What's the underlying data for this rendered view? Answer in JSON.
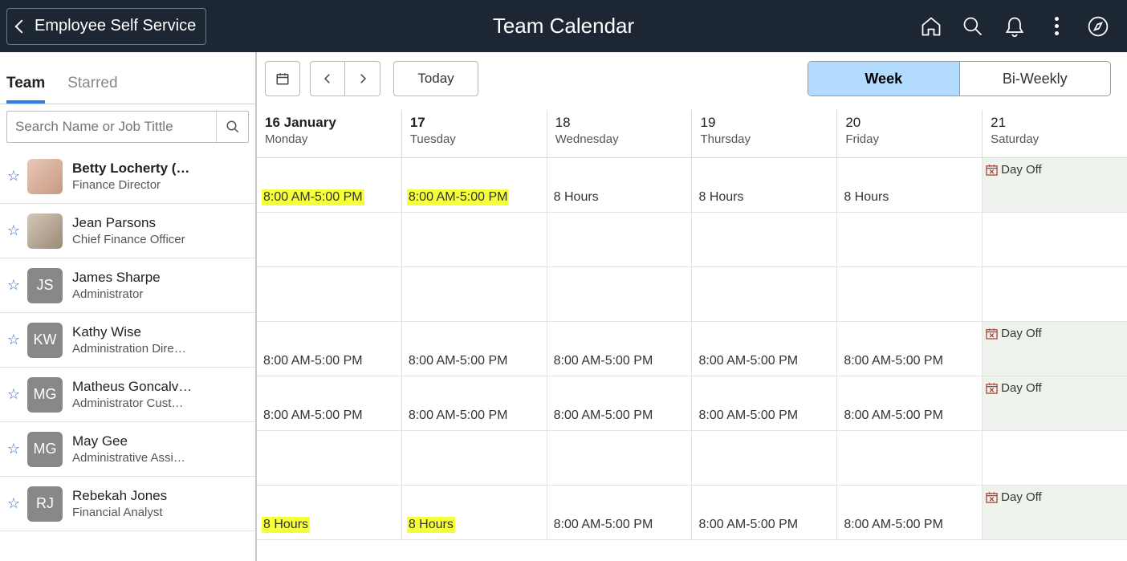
{
  "header": {
    "back_label": "Employee Self Service",
    "title": "Team Calendar"
  },
  "sidebar": {
    "tabs": {
      "team": "Team",
      "starred": "Starred"
    },
    "search_placeholder": "Search Name or Job Tittle",
    "members": [
      {
        "name": "Betty Locherty (…",
        "title": "Finance Director",
        "bold": true,
        "avatar_type": "photo1",
        "initials": ""
      },
      {
        "name": "Jean Parsons",
        "title": "Chief Finance Officer",
        "bold": false,
        "avatar_type": "photo2",
        "initials": ""
      },
      {
        "name": "James Sharpe",
        "title": "Administrator",
        "bold": false,
        "avatar_type": "initials",
        "initials": "JS"
      },
      {
        "name": "Kathy Wise",
        "title": "Administration Dire…",
        "bold": false,
        "avatar_type": "initials",
        "initials": "KW"
      },
      {
        "name": "Matheus Goncalv…",
        "title": "Administrator Cust…",
        "bold": false,
        "avatar_type": "initials",
        "initials": "MG"
      },
      {
        "name": "May Gee",
        "title": "Administrative Assi…",
        "bold": false,
        "avatar_type": "initials",
        "initials": "MG"
      },
      {
        "name": "Rebekah Jones",
        "title": "Financial Analyst",
        "bold": false,
        "avatar_type": "initials",
        "initials": "RJ"
      }
    ]
  },
  "toolbar": {
    "today": "Today",
    "segments": {
      "week": "Week",
      "biweekly": "Bi-Weekly"
    }
  },
  "days": [
    {
      "num": "16 January",
      "name": "Monday",
      "bold": true
    },
    {
      "num": "17",
      "name": "Tuesday",
      "bold": true
    },
    {
      "num": "18",
      "name": "Wednesday",
      "bold": false
    },
    {
      "num": "19",
      "name": "Thursday",
      "bold": false
    },
    {
      "num": "20",
      "name": "Friday",
      "bold": false
    },
    {
      "num": "21",
      "name": "Saturday",
      "bold": false
    }
  ],
  "dayoff_label": "Day Off",
  "grid": [
    [
      {
        "v": "8:00 AM-5:00 PM",
        "hl": true
      },
      {
        "v": "8:00 AM-5:00 PM",
        "hl": true
      },
      {
        "v": "8 Hours"
      },
      {
        "v": "8 Hours"
      },
      {
        "v": "8 Hours"
      },
      {
        "dayoff": true
      }
    ],
    [
      {},
      {},
      {},
      {},
      {},
      {}
    ],
    [
      {},
      {},
      {},
      {},
      {},
      {}
    ],
    [
      {
        "v": "8:00 AM-5:00 PM"
      },
      {
        "v": "8:00 AM-5:00 PM"
      },
      {
        "v": "8:00 AM-5:00 PM"
      },
      {
        "v": "8:00 AM-5:00 PM"
      },
      {
        "v": "8:00 AM-5:00 PM"
      },
      {
        "dayoff": true
      }
    ],
    [
      {
        "v": "8:00 AM-5:00 PM"
      },
      {
        "v": "8:00 AM-5:00 PM"
      },
      {
        "v": "8:00 AM-5:00 PM"
      },
      {
        "v": "8:00 AM-5:00 PM"
      },
      {
        "v": "8:00 AM-5:00 PM"
      },
      {
        "dayoff": true
      }
    ],
    [
      {},
      {},
      {},
      {},
      {},
      {}
    ],
    [
      {
        "v": "8 Hours",
        "hl": true
      },
      {
        "v": "8 Hours",
        "hl": true
      },
      {
        "v": "8:00 AM-5:00 PM"
      },
      {
        "v": "8:00 AM-5:00 PM"
      },
      {
        "v": "8:00 AM-5:00 PM"
      },
      {
        "dayoff": true
      }
    ]
  ]
}
